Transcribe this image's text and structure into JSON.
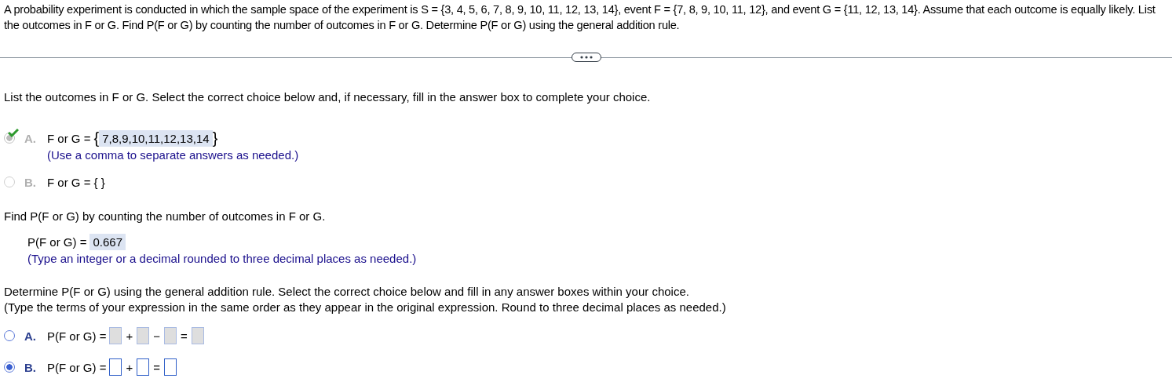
{
  "question": "A probability experiment is conducted in which the sample space of the experiment is S = {3, 4, 5, 6, 7, 8, 9, 10, 11, 12, 13, 14}, event F = {7, 8, 9, 10, 11, 12}, and event G = {11, 12, 13, 14}. Assume that each outcome is equally likely. List the outcomes in F or G. Find P(F or G) by counting the number of outcomes in F or G. Determine P(F or G) using the general addition rule.",
  "part1": {
    "prompt": "List the outcomes in F or G. Select the correct choice below and, if necessary, fill in the answer box to complete your choice.",
    "choices": [
      {
        "letter": "A.",
        "selected": true,
        "disabled": true,
        "correct": true,
        "tokens": [
          {
            "kind": "text",
            "text": "F or G ="
          },
          {
            "kind": "brace",
            "text": "{"
          },
          {
            "kind": "answer",
            "text": "7,8,9,10,11,12,13,14"
          },
          {
            "kind": "brace",
            "text": "}"
          }
        ],
        "hint": "(Use a comma to separate answers as needed.)"
      },
      {
        "letter": "B.",
        "selected": false,
        "disabled": true,
        "correct": false,
        "tokens": [
          {
            "kind": "text",
            "text": "F or G = { }"
          }
        ]
      }
    ]
  },
  "part2": {
    "prompt": "Find P(F or G) by counting the number of outcomes in F or G.",
    "label": "P(F or G) =",
    "answer": "0.667",
    "hint": "(Type an integer or a decimal rounded to three decimal places as needed.)"
  },
  "part3": {
    "prompt": "Determine P(F or G) using the general addition rule. Select the correct choice below and fill in any answer boxes within your choice.",
    "note": "(Type the terms of your expression in the same order as they appear in the original expression. Round to three decimal places as needed.)",
    "choices": [
      {
        "letter": "A.",
        "selected": false,
        "disabled": false,
        "tokens": [
          {
            "kind": "text",
            "text": "P(F or G) ="
          },
          {
            "kind": "box",
            "disabled": true
          },
          {
            "kind": "op",
            "text": "+"
          },
          {
            "kind": "box",
            "disabled": true
          },
          {
            "kind": "op",
            "text": "−"
          },
          {
            "kind": "box",
            "disabled": true
          },
          {
            "kind": "op",
            "text": "="
          },
          {
            "kind": "box",
            "disabled": true
          }
        ]
      },
      {
        "letter": "B.",
        "selected": true,
        "disabled": false,
        "tokens": [
          {
            "kind": "text",
            "text": "P(F or G) ="
          },
          {
            "kind": "box",
            "disabled": false
          },
          {
            "kind": "op",
            "text": "+"
          },
          {
            "kind": "box",
            "disabled": false
          },
          {
            "kind": "op",
            "text": "="
          },
          {
            "kind": "box",
            "disabled": false
          }
        ]
      }
    ]
  }
}
